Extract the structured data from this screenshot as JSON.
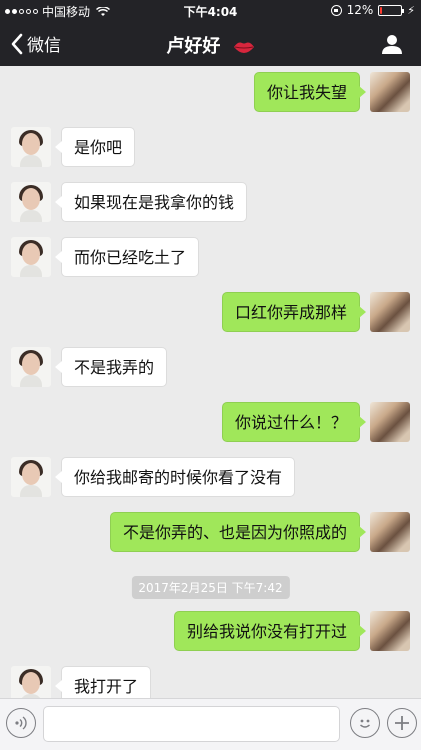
{
  "status_bar": {
    "carrier": "中国移动",
    "time": "下午4:04",
    "battery": "12%",
    "battery_level": 0.12
  },
  "nav": {
    "back_label": "微信",
    "title": "卢好好",
    "title_icon": "lips-icon",
    "profile_icon": "profile-icon"
  },
  "messages": [
    {
      "side": "right",
      "text": "你让我失望"
    },
    {
      "side": "left",
      "text": "是你吧"
    },
    {
      "side": "left",
      "text": "如果现在是我拿你的钱"
    },
    {
      "side": "left",
      "text": "而你已经吃土了"
    },
    {
      "side": "right",
      "text": "口红你弄成那样"
    },
    {
      "side": "left",
      "text": "不是我弄的"
    },
    {
      "side": "right",
      "text": "你说过什么！？"
    },
    {
      "side": "left",
      "text": "你给我邮寄的时候你看了没有"
    },
    {
      "side": "right",
      "text": "不是你弄的、也是因为你照成的"
    },
    {
      "side": "right",
      "text": "别给我说你没有打开过"
    },
    {
      "side": "left",
      "text": "我打开了"
    }
  ],
  "timestamp": "2017年2月25日 下午7:42",
  "input_bar": {
    "voice_icon": "voice-icon",
    "placeholder": "",
    "emoji_icon": "emoji-icon",
    "plus_icon": "plus-icon"
  },
  "colors": {
    "header_bg": "#232327",
    "chat_bg": "#ebebeb",
    "sent_bubble": "#a0e75a",
    "received_bubble": "#ffffff",
    "battery_low": "#ff3b30"
  }
}
